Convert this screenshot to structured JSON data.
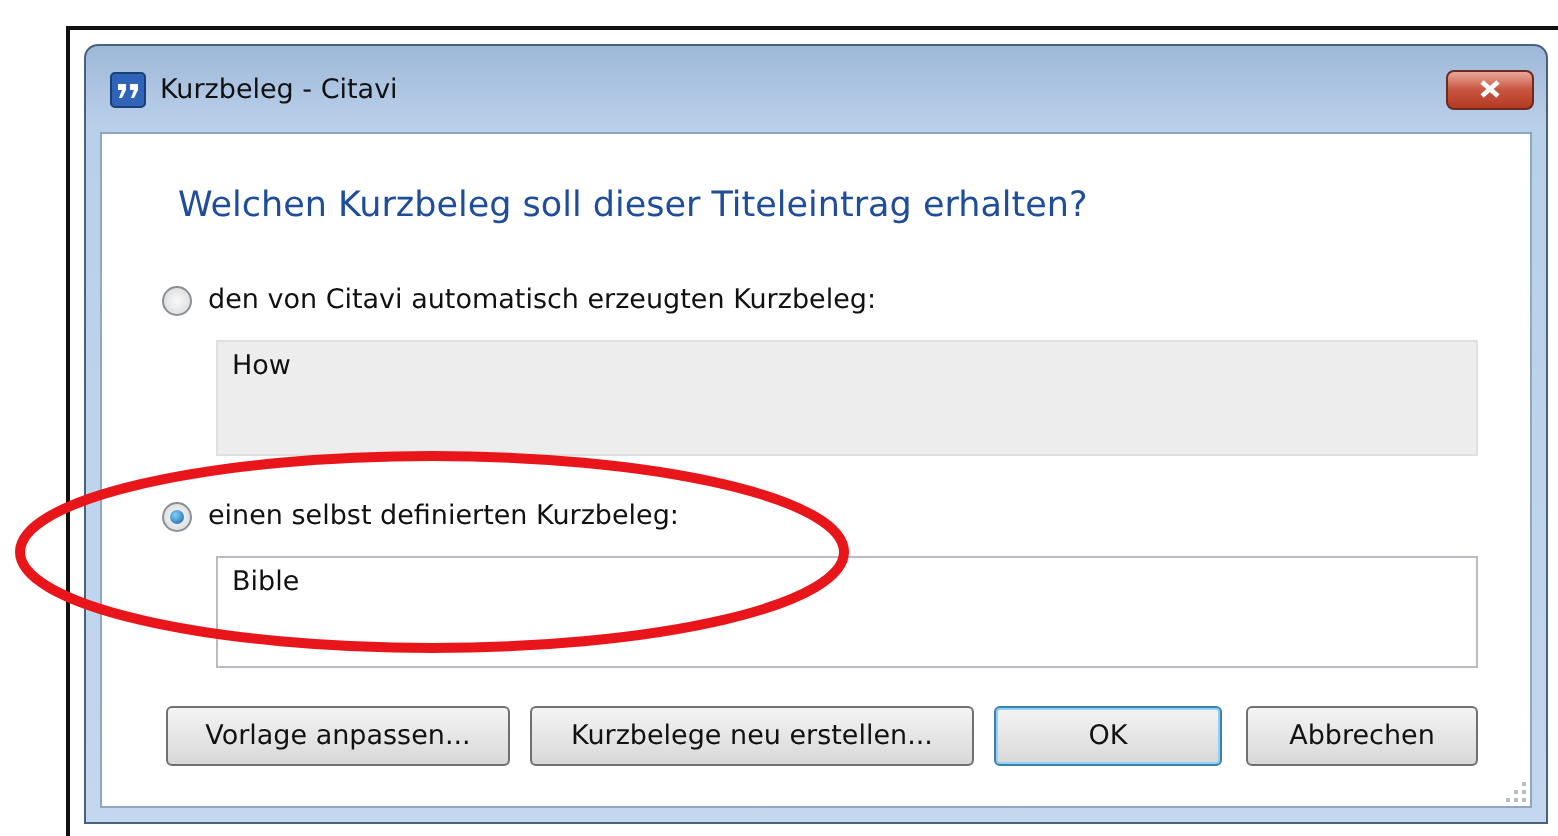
{
  "window": {
    "title": "Kurzbeleg - Citavi"
  },
  "heading": "Welchen Kurzbeleg soll dieser Titeleintrag erhalten?",
  "options": [
    {
      "label": "den von Citavi automatisch erzeugten Kurzbeleg:",
      "selected": false,
      "value": "How",
      "readonly": true
    },
    {
      "label": "einen selbst definierten Kurzbeleg:",
      "selected": true,
      "value": "Bible",
      "readonly": false
    }
  ],
  "buttons": [
    {
      "label": "Vorlage anpassen...",
      "default": false
    },
    {
      "label": "Kurzbelege neu erstellen...",
      "default": false
    },
    {
      "label": "OK",
      "default": true
    },
    {
      "label": "Abbrechen",
      "default": false
    }
  ],
  "annotation": {
    "kind": "ellipse"
  }
}
